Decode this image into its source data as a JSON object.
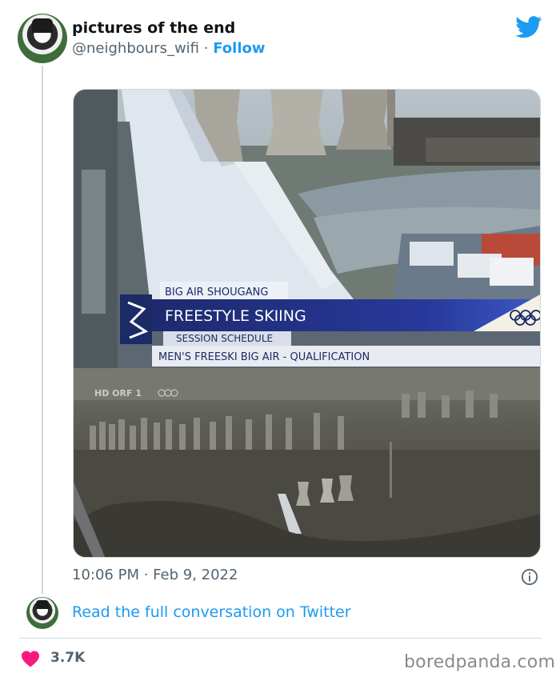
{
  "tweet": {
    "author_name": "pictures of the end",
    "handle": "@neighbours_wifi",
    "separator": "·",
    "follow_label": "Follow",
    "timestamp": "10:06 PM · Feb 9, 2022",
    "media": {
      "broadcast_venue": "BIG AIR SHOUGANG",
      "broadcast_title": "FREESTYLE SKIING",
      "broadcast_subtitle": "SESSION SCHEDULE",
      "broadcast_event": "MEN'S FREESKI BIG AIR - QUALIFICATION",
      "channel_bug": "HD ORF 1"
    },
    "conversation_link": "Read the full conversation on Twitter",
    "like_count": "3.7K"
  },
  "watermark": "boredpanda.com",
  "icons": {
    "brand": "twitter-bird-icon",
    "info": "info-icon",
    "like": "heart-icon"
  },
  "colors": {
    "accent": "#1d9bf0",
    "secondary_text": "#536471",
    "heart": "#f91880"
  }
}
